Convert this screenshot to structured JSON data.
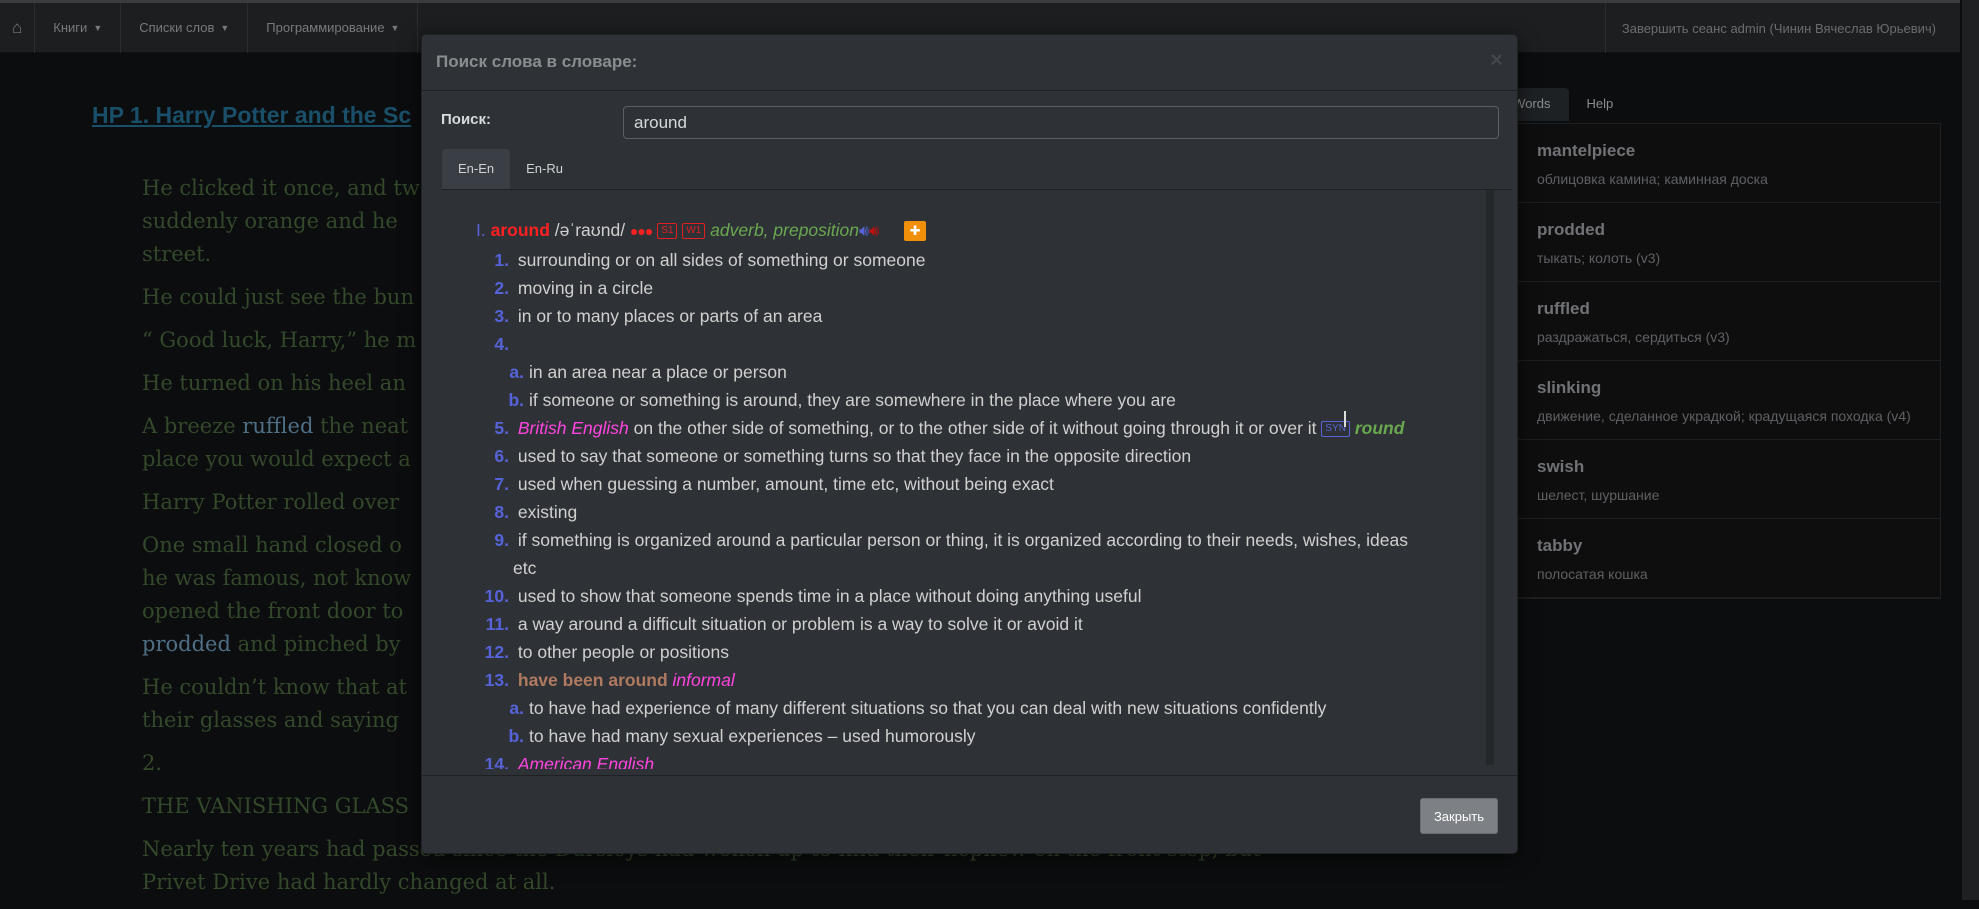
{
  "navbar": {
    "home_icon": "home-icon",
    "items": [
      {
        "label": "Книги"
      },
      {
        "label": "Списки слов"
      },
      {
        "label": "Программирование"
      }
    ],
    "logout": "Завершить сеанс admin (Чинин Вячеслав Юрьевич)"
  },
  "book": {
    "title": "HP 1. Harry Potter and the Sc",
    "paragraphs": [
      {
        "lines": [
          "He clicked it once, and tw",
          "suddenly orange and he",
          "street."
        ]
      },
      {
        "lines": [
          "He could just see the bun"
        ]
      },
      {
        "lines": [
          "“ Good luck, Harry,” he m"
        ]
      },
      {
        "lines": [
          "He turned on his heel an"
        ]
      },
      {
        "lines": [
          "A breeze ",
          "ruffled",
          " the neat",
          "place you would expect a"
        ]
      },
      {
        "lines": [
          "Harry Potter rolled over"
        ]
      },
      {
        "lines": [
          "One small hand closed o",
          "he was famous, not know",
          "opened the front door to",
          "prodded",
          " and pinched by"
        ]
      },
      {
        "lines": [
          "He couldn’t know that at",
          "their glasses and saying"
        ]
      },
      {
        "lines": [
          "2."
        ]
      },
      {
        "lines": [
          "THE VANISHING GLASS"
        ]
      },
      {
        "lines": [
          "Nearly ten years had passed since the Dursleys had woken up to find their nephew on the front step, but",
          "Privet Drive had hardly changed at all."
        ]
      }
    ]
  },
  "right_panel": {
    "tabs": [
      {
        "label": "rn Words"
      },
      {
        "label": "Help"
      }
    ],
    "words": [
      {
        "word": "mantelpiece",
        "translation": "облицовка камина; каминная доска"
      },
      {
        "word": "prodded",
        "translation": "тыкать; колоть (v3)"
      },
      {
        "word": "ruffled",
        "translation": "раздражаться, сердиться (v3)"
      },
      {
        "word": "slinking",
        "translation": "движение, сделанное украдкой; крадущаяся походка (v4)"
      },
      {
        "word": "swish",
        "translation": "шелест, шуршание"
      },
      {
        "word": "tabby",
        "translation": "полосатая кошка"
      }
    ]
  },
  "modal": {
    "title": "Поиск слова в словаре:",
    "close_symbol": "×",
    "search_label": "Поиск:",
    "search_value": "around",
    "tabs": [
      {
        "label": "En-En",
        "active": true
      },
      {
        "label": "En-Ru",
        "active": false
      }
    ],
    "entry": {
      "roman": "I.",
      "headword": "around",
      "pronunciation": "/əˈraʊnd/",
      "frequency_dots": "●●●",
      "badges": [
        "S1",
        "W1"
      ],
      "pos": "adverb, preposition",
      "icons": [
        "speaker-blue-icon",
        "speaker-red-icon",
        "add-icon"
      ],
      "senses": [
        {
          "n": "1.",
          "text": "surrounding or on all sides of something or someone"
        },
        {
          "n": "2.",
          "text": "moving in a circle"
        },
        {
          "n": "3.",
          "text": "in or to many places or parts of an area"
        },
        {
          "n": "4.",
          "text": "",
          "sub": [
            {
              "n": "a.",
              "text": "in an area near a place or person"
            },
            {
              "n": "b.",
              "text": "if someone or something is around, they are somewhere in the place where you are"
            }
          ]
        },
        {
          "n": "5.",
          "register": "British English",
          "text": " on the other side of something, or to the other side of it without going through it or over it ",
          "syn_label": "SYN",
          "syn": "round"
        },
        {
          "n": "6.",
          "text": "used to say that someone or something turns so that they face in the opposite direction"
        },
        {
          "n": "7.",
          "text": "used when guessing a number, amount, time etc, without being exact"
        },
        {
          "n": "8.",
          "text": "existing"
        },
        {
          "n": "9.",
          "text": "if something is organized around a particular person or thing, it is organized according to their needs, wishes, ideas",
          "cont": "etc"
        },
        {
          "n": "10.",
          "text": "used to show that someone spends time in a place without doing anything useful"
        },
        {
          "n": "11.",
          "text": "a way around a difficult situation or problem is a way to solve it or avoid it"
        },
        {
          "n": "12.",
          "text": "to other people or positions"
        },
        {
          "n": "13.",
          "phrase": "have been around",
          "register": "informal",
          "sub": [
            {
              "n": "a.",
              "text": "to have had experience of many different situations so that you can deal with new situations confidently"
            },
            {
              "n": "b.",
              "text": "to have had many sexual experiences – used humorously"
            }
          ]
        },
        {
          "n": "14.",
          "register": "American English"
        }
      ]
    },
    "close_button": "Закрыть"
  },
  "colors": {
    "headword": "#ff2020",
    "number": "#5663d8",
    "pos": "#6aa84f",
    "register": "#ff44e0",
    "phrase": "#b07a60",
    "add_button": "#f0900a"
  }
}
